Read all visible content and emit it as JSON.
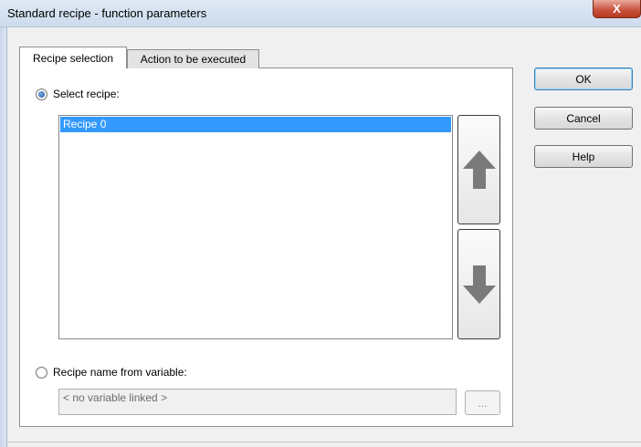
{
  "window": {
    "title": "Standard recipe - function parameters",
    "close_glyph": "X"
  },
  "tabs": [
    {
      "label": "Recipe selection",
      "active": true
    },
    {
      "label": "Action to be executed",
      "active": false
    }
  ],
  "select_recipe": {
    "label": "Select recipe:",
    "selected": true,
    "items": [
      "Recipe 0"
    ]
  },
  "variable_option": {
    "label": "Recipe name from variable:",
    "selected": false,
    "field_value": "< no variable linked >",
    "browse_label": "..."
  },
  "buttons": {
    "ok": "OK",
    "cancel": "Cancel",
    "help": "Help"
  },
  "icons": {
    "move_up": "arrow-up-icon",
    "move_down": "arrow-down-icon"
  },
  "colors": {
    "selection": "#3399ff",
    "arrow": "#7a7a7a"
  }
}
